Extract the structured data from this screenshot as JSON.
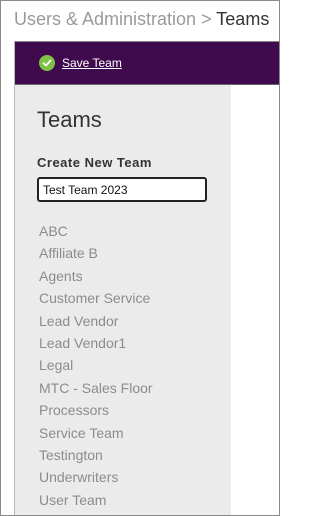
{
  "breadcrumb": {
    "parent": "Users & Administration",
    "separator": ">",
    "current": "Teams"
  },
  "toolbar": {
    "save_label": "Save Team",
    "save_icon": "check-circle-icon",
    "background_color": "#400a4e",
    "icon_color": "#7ec144"
  },
  "sidebar": {
    "title": "Teams",
    "create_label": "Create New Team",
    "input_value": "Test Team 2023",
    "teams": [
      "ABC",
      "Affiliate B",
      "Agents",
      "Customer Service",
      "Lead Vendor",
      "Lead Vendor1",
      "Legal",
      "MTC - Sales Floor",
      "Processors",
      "Service Team",
      "Testington",
      "Underwriters",
      "User Team"
    ]
  }
}
